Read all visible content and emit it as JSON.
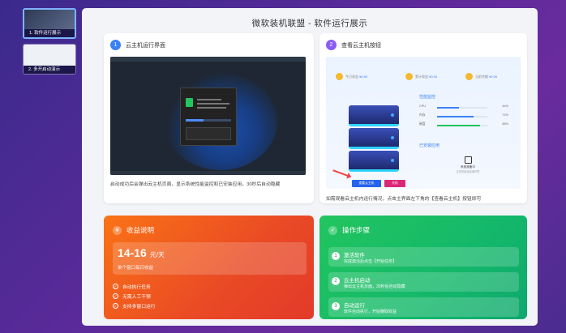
{
  "thumbnails": [
    {
      "label": "1. 软件运行展示",
      "active": true
    },
    {
      "label": "2. 多开启动演示",
      "active": false
    }
  ],
  "slide": {
    "title": "微软装机联盟 - 软件运行展示",
    "card1": {
      "num": "1",
      "heading": "云主机运行界面",
      "caption": "启动成功后会弹出云主机页面，显示系统性能监控和已安装应用，30秒后自动隐藏"
    },
    "card2": {
      "num": "2",
      "heading": "查看云主机按钮",
      "stats": [
        {
          "label": "今日收益",
          "value": "¥0.00"
        },
        {
          "label": "累计收益",
          "value": "¥0.00"
        },
        {
          "label": "当前余额",
          "value": "¥0.00"
        }
      ],
      "panel_title": "性能监控",
      "metrics": [
        {
          "label": "CPU",
          "pct": "44%",
          "value": 0.44,
          "color": "#3b82f6"
        },
        {
          "label": "内存",
          "pct": "72%",
          "value": 0.72,
          "color": "#3b82f6"
        },
        {
          "label": "磁盘",
          "pct": "85%",
          "value": 0.85,
          "color": "#22c55e"
        }
      ],
      "apps_title": "已安装应用",
      "app_name": "系统准备中",
      "app_desc": "正在初始化应用环境",
      "btn_view": "查看云主机",
      "btn_off": "关机",
      "caption": "如需观看云主机内运行情况，点击主界面左下角的【查看云主机】按钮即可"
    },
    "income": {
      "icon": "¥",
      "title": "收益说明",
      "price": "14-16",
      "unit": "元/天",
      "price_sub": "单个窗口每日收益",
      "features": [
        "自动执行任务",
        "无需人工干预",
        "支持多窗口运行"
      ]
    },
    "steps": {
      "icon": "✓",
      "title": "操作步骤",
      "items": [
        {
          "num": "1",
          "title": "激活软件",
          "desc": "完成激活后点击【开始任务】"
        },
        {
          "num": "2",
          "title": "云主机启动",
          "desc": "弹出云主机页面，30秒后自动隐藏"
        },
        {
          "num": "3",
          "title": "自动运行",
          "desc": "软件自动执行，开始赚取收益"
        }
      ]
    }
  }
}
